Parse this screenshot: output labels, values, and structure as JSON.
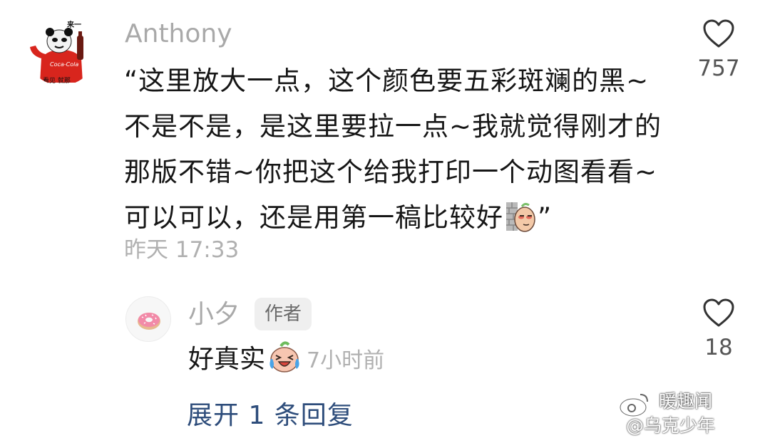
{
  "comment": {
    "username": "Anthony",
    "text": "“这里放大一点，这个颜色要五彩斑斓的黑~不是不是，是这里要拉一点~我就觉得刚才的那版不错~你把这个给我打印一个动图看看~可以可以，还是用第一稿比较好",
    "text_end": "”",
    "inline_emoji": "peeking-emoji",
    "timestamp": "昨天 17:33",
    "like_count": "757",
    "avatar_caption_top": "来一",
    "avatar_caption_bottom": "看见 就那",
    "avatar_brand": "Coca-Cola"
  },
  "reply": {
    "username": "小夕",
    "badge": "作者",
    "text": "好真实",
    "inline_emoji": "crying-laughing-emoji",
    "time": "7小时前",
    "like_count": "18"
  },
  "expand_replies_label": "展开 1 条回复",
  "watermark": {
    "line1": "暖趣闻",
    "line2": "@乌克少年"
  },
  "colors": {
    "username": "#a9a9a9",
    "body_text": "#161616",
    "meta_text": "#b0b0b0",
    "link": "#2e4d7b",
    "badge_bg": "#efefef"
  }
}
